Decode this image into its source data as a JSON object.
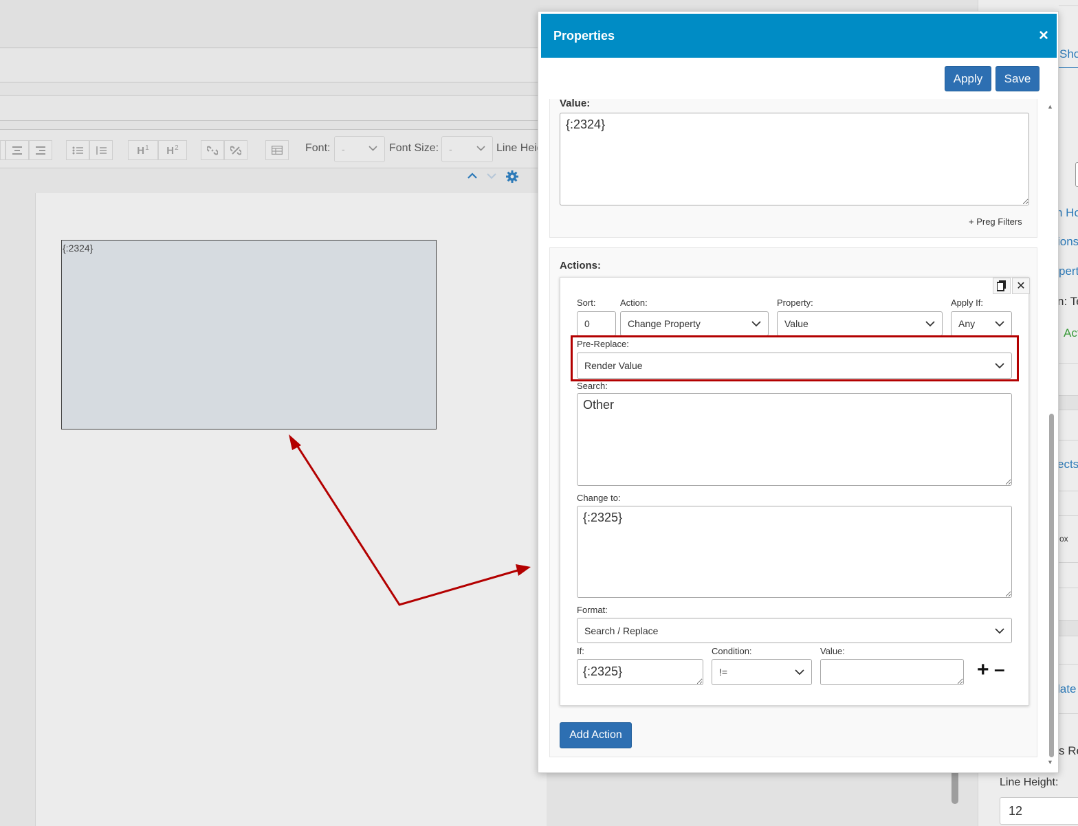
{
  "toolbar": {
    "font_label": "Font:",
    "font_value": "-",
    "font_size_label": "Font Size:",
    "font_size_value": "-",
    "line_height_label": "Line Heig"
  },
  "canvas": {
    "textbox_text": "{:2324}"
  },
  "right_panel": {
    "texts": [
      "Sho",
      "n Ho",
      "ions",
      "pert",
      "n: Te",
      "Act",
      "ects",
      "ox",
      "late",
      "s Re"
    ],
    "line_height_label": "Line Height:",
    "line_height_value": "12"
  },
  "modal": {
    "title": "Properties",
    "close_icon": "×",
    "apply_label": "Apply",
    "save_label": "Save",
    "value_section": {
      "label": "Value:",
      "value": "{:2324}",
      "preg_filters_label": "+ Preg Filters"
    },
    "actions": {
      "label": "Actions:",
      "sort_label": "Sort:",
      "sort_value": "0",
      "action_label": "Action:",
      "action_value": "Change Property",
      "property_label": "Property:",
      "property_value": "Value",
      "apply_if_label": "Apply If:",
      "apply_if_value": "Any",
      "pre_replace_label": "Pre-Replace:",
      "pre_replace_value": "Render Value",
      "search_label": "Search:",
      "search_value": "Other",
      "change_to_label": "Change to:",
      "change_to_value": "{:2325}",
      "format_label": "Format:",
      "format_value": "Search / Replace",
      "if_label": "If:",
      "if_value": "{:2325}",
      "condition_label": "Condition:",
      "condition_value": "!=",
      "value_label": "Value:",
      "value_value": "",
      "plus_icon": "+",
      "minus_icon": "–",
      "copy_icon": "copy-icon",
      "remove_icon": "✕"
    },
    "add_action_label": "Add Action"
  },
  "colors": {
    "header_bg": "#008cc5",
    "primary_button": "#2d6fb2",
    "highlight": "#b30000",
    "link": "#2d7ab8"
  }
}
